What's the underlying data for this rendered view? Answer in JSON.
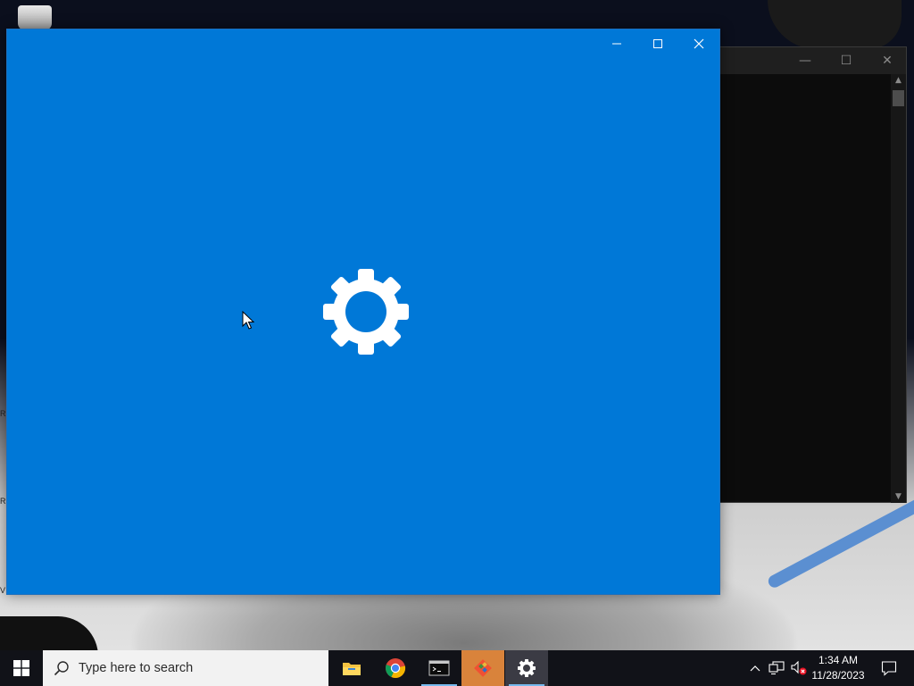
{
  "desktop": {
    "icons": [
      "recycle-bin-icon"
    ]
  },
  "console_window": {
    "controls": {
      "minimize": "—",
      "maximize": "☐",
      "close": "✕"
    },
    "scroll": {
      "up": "▲",
      "down": "▼"
    }
  },
  "settings_window": {
    "app": "Settings",
    "state": "loading splash",
    "background_color": "#0078d7",
    "icon": "gear-icon",
    "controls": [
      "minimize",
      "maximize",
      "close"
    ]
  },
  "taskbar": {
    "start_icon": "windows-logo-icon",
    "search": {
      "placeholder": "Type here to search",
      "icon": "search-icon"
    },
    "apps": [
      {
        "name": "File Explorer",
        "icon": "folder-icon"
      },
      {
        "name": "Google Chrome",
        "icon": "chrome-icon"
      },
      {
        "name": "Command Prompt",
        "icon": "terminal-icon"
      },
      {
        "name": "Git",
        "icon": "git-icon"
      },
      {
        "name": "Settings",
        "icon": "gear-icon"
      }
    ],
    "tray": {
      "icons": [
        "chevron-up-icon",
        "network-icon",
        "volume-muted-icon"
      ],
      "time": "1:34 AM",
      "date": "11/28/2023",
      "notification_icon": "notification-icon"
    }
  },
  "colors": {
    "settings_blue": "#0078d7",
    "taskbar": "#111218",
    "search_box": "#f2f2f2",
    "active_underline": "#76b9ed",
    "git_highlight": "#d9833b"
  }
}
